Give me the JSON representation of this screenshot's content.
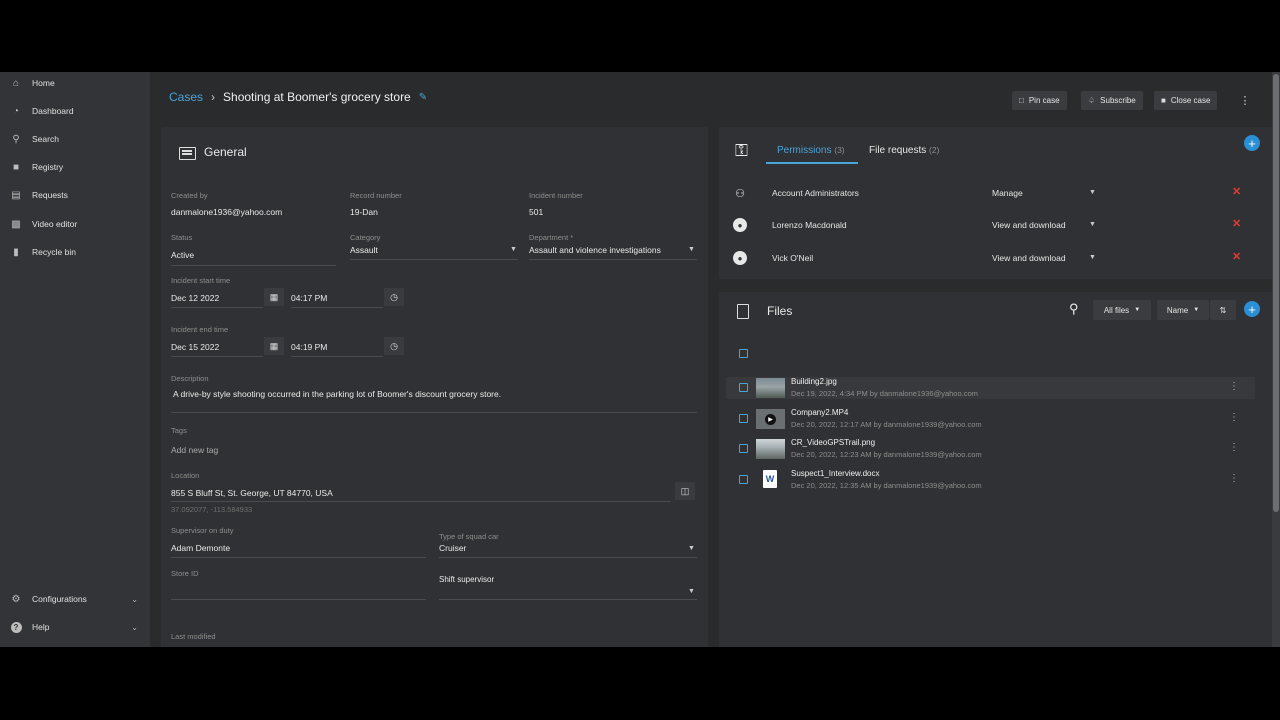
{
  "sidebar": {
    "items": [
      {
        "label": "Home",
        "icon": "home-icon"
      },
      {
        "label": "Dashboard",
        "icon": "dashboard-icon"
      },
      {
        "label": "Search",
        "icon": "search-icon"
      },
      {
        "label": "Registry",
        "icon": "camera-icon"
      },
      {
        "label": "Requests",
        "icon": "requests-icon"
      },
      {
        "label": "Video editor",
        "icon": "video-editor-icon"
      },
      {
        "label": "Recycle bin",
        "icon": "trash-icon"
      }
    ],
    "bottom": [
      {
        "label": "Configurations",
        "icon": "gear-icon"
      },
      {
        "label": "Help",
        "icon": "help-icon"
      }
    ]
  },
  "header": {
    "breadcrumb_link": "Cases",
    "title": "Shooting at Boomer's grocery store",
    "pin_label": "Pin case",
    "subscribe_label": "Subscribe",
    "close_label": "Close case"
  },
  "general": {
    "title": "General",
    "created_by_label": "Created by",
    "created_by": "danmalone1936@yahoo.com",
    "record_label": "Record number",
    "record": "19-Dan",
    "incident_number_label": "Incident number",
    "incident_number": "501",
    "status_label": "Status",
    "status": "Active",
    "category_label": "Category",
    "category": "Assault",
    "department_label": "Department *",
    "department": "Assault and violence investigations",
    "start_label": "Incident start time",
    "start_date": "Dec 12 2022",
    "start_time": "04:17 PM",
    "end_label": "Incident end time",
    "end_date": "Dec 15 2022",
    "end_time": "04:19 PM",
    "description_label": "Description",
    "description": "A drive-by style shooting occurred in the parking lot of Boomer's discount grocery store.",
    "tags_label": "Tags",
    "tags_placeholder": "Add new tag",
    "location_label": "Location",
    "location": "855 S Bluff St, St. George, UT 84770, USA",
    "coords": "37.092077, -113.584933",
    "supervisor_label": "Supervisor on duty",
    "supervisor": "Adam Demonte",
    "squad_label": "Type of squad car",
    "squad": "Cruiser",
    "store_label": "Store ID",
    "shift_label": "Shift supervisor",
    "modified_label": "Last modified"
  },
  "permissions": {
    "tab_permissions": "Permissions",
    "tab_permissions_count": "(3)",
    "tab_files": "File requests",
    "tab_files_count": "(2)",
    "rows": [
      {
        "name": "Account Administrators",
        "role": "Manage",
        "icon": "group-icon"
      },
      {
        "name": "Lorenzo Macdonald",
        "role": "View and download",
        "icon": "user-icon"
      },
      {
        "name": "Vick O'Neil",
        "role": "View and download",
        "icon": "user-icon"
      }
    ]
  },
  "files": {
    "title": "Files",
    "filter": "All files",
    "sort": "Name",
    "rows": [
      {
        "name": "Building2.jpg",
        "meta": "Dec 19, 2022, 4:34 PM by danmalone1936@yahoo.com"
      },
      {
        "name": "Company2.MP4",
        "meta": "Dec 20, 2022, 12:17 AM by danmalone1939@yahoo.com"
      },
      {
        "name": "CR_VideoGPSTrail.png",
        "meta": "Dec 20, 2022, 12:23 AM by danmalone1939@yahoo.com"
      },
      {
        "name": "Suspect1_Interview.docx",
        "meta": "Dec 20, 2022, 12:35 AM by danmalone1939@yahoo.com"
      }
    ]
  },
  "colors": {
    "accent": "#4aa3d9",
    "danger": "#e53935",
    "background": "#2a2b2d",
    "card": "#303134"
  }
}
